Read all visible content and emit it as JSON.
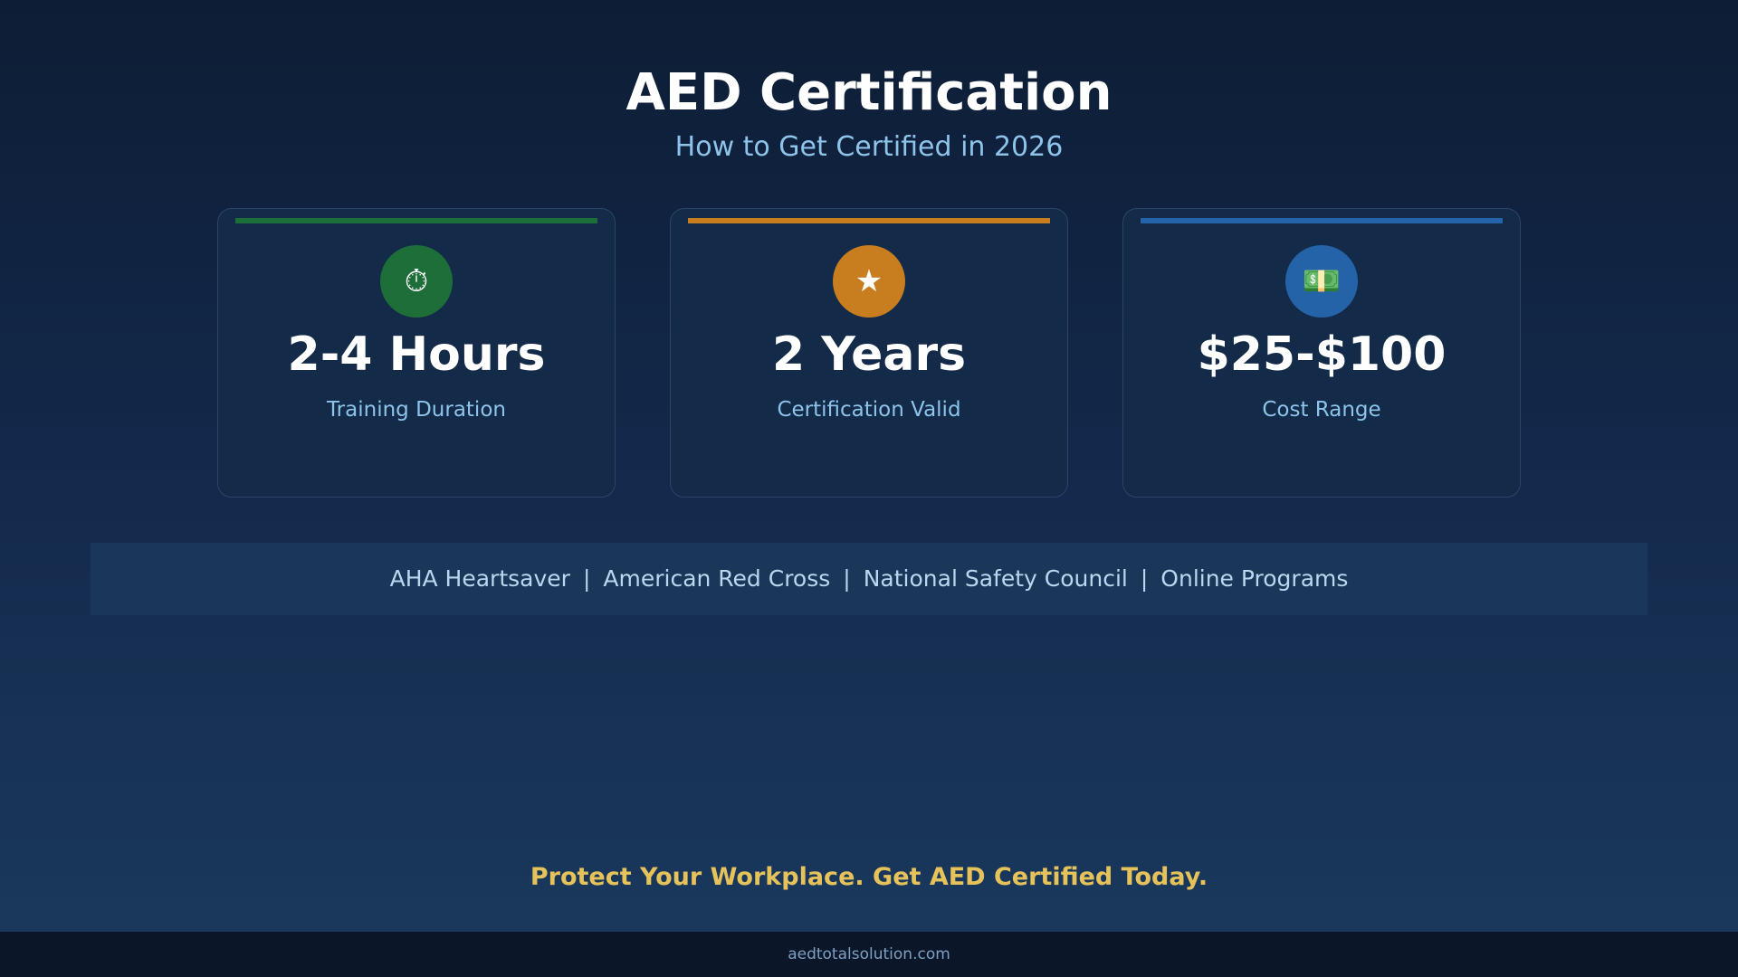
{
  "header": {
    "title": "AED Certification",
    "subtitle": "How to Get Certified in 2026"
  },
  "cards": [
    {
      "icon": "clock-icon",
      "icon_glyph": "⏱",
      "value": "2-4 Hours",
      "label": "Training Duration",
      "color": "#1e6e3a"
    },
    {
      "icon": "star-icon",
      "icon_glyph": "★",
      "value": "2 Years",
      "label": "Certification Valid",
      "color": "#c87e1e"
    },
    {
      "icon": "money-icon",
      "icon_glyph": "💵",
      "value": "$25-$100",
      "label": "Cost Range",
      "color": "#2563a8"
    }
  ],
  "providers": {
    "items": [
      "AHA Heartsaver",
      "American Red Cross",
      "National Safety Council",
      "Online Programs"
    ],
    "separator": "|"
  },
  "cta": {
    "text": "Protect Your Workplace. Get AED Certified Today."
  },
  "footer": {
    "text": "aedtotalsolution.com"
  },
  "colors": {
    "title": "#ffffff",
    "subtitle": "#8ec3ea",
    "cta": "#e6c35a",
    "background_top": "#0d1d35",
    "background_bottom": "#1a3a5e"
  }
}
